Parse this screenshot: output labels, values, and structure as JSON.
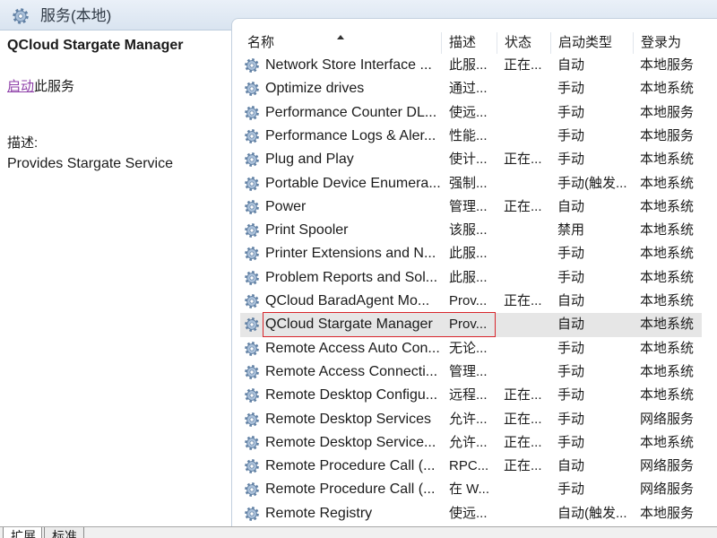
{
  "window": {
    "title": "服务(本地)",
    "icon": "gear-icon"
  },
  "details": {
    "service_name": "QCloud Stargate Manager",
    "action_link": "启动",
    "action_text": "此服务",
    "description_label": "描述:",
    "description": "Provides Stargate Service"
  },
  "list": {
    "columns": [
      "名称",
      "描述",
      "状态",
      "启动类型",
      "登录为"
    ],
    "sort_icon": "sort-ascending-icon",
    "rows": [
      {
        "icon": "service-gear-icon",
        "name": "Network Store Interface ...",
        "description": "此服...",
        "status": "正在...",
        "startup_type": "自动",
        "log_on_as": "本地服务"
      },
      {
        "icon": "service-gear-icon",
        "name": "Optimize drives",
        "description": "通过...",
        "status": "",
        "startup_type": "手动",
        "log_on_as": "本地系统"
      },
      {
        "icon": "service-gear-icon",
        "name": "Performance Counter DL...",
        "description": "使远...",
        "status": "",
        "startup_type": "手动",
        "log_on_as": "本地服务"
      },
      {
        "icon": "service-gear-icon",
        "name": "Performance Logs & Aler...",
        "description": "性能...",
        "status": "",
        "startup_type": "手动",
        "log_on_as": "本地服务"
      },
      {
        "icon": "service-gear-icon",
        "name": "Plug and Play",
        "description": "使计...",
        "status": "正在...",
        "startup_type": "手动",
        "log_on_as": "本地系统"
      },
      {
        "icon": "service-gear-icon",
        "name": "Portable Device Enumera...",
        "description": "强制...",
        "status": "",
        "startup_type": "手动(触发...",
        "log_on_as": "本地系统"
      },
      {
        "icon": "service-gear-icon",
        "name": "Power",
        "description": "管理...",
        "status": "正在...",
        "startup_type": "自动",
        "log_on_as": "本地系统"
      },
      {
        "icon": "service-gear-icon",
        "name": "Print Spooler",
        "description": "该服...",
        "status": "",
        "startup_type": "禁用",
        "log_on_as": "本地系统"
      },
      {
        "icon": "service-gear-icon",
        "name": "Printer Extensions and N...",
        "description": "此服...",
        "status": "",
        "startup_type": "手动",
        "log_on_as": "本地系统"
      },
      {
        "icon": "service-gear-icon",
        "name": "Problem Reports and Sol...",
        "description": "此服...",
        "status": "",
        "startup_type": "手动",
        "log_on_as": "本地系统"
      },
      {
        "icon": "service-gear-icon",
        "name": "QCloud BaradAgent Mo...",
        "description": "Prov...",
        "status": "正在...",
        "startup_type": "自动",
        "log_on_as": "本地系统"
      },
      {
        "icon": "service-gear-icon",
        "name": "QCloud Stargate Manager",
        "description": "Prov...",
        "status": "",
        "startup_type": "自动",
        "log_on_as": "本地系统",
        "selected": true,
        "outlined": true
      },
      {
        "icon": "service-gear-icon",
        "name": "Remote Access Auto Con...",
        "description": "无论...",
        "status": "",
        "startup_type": "手动",
        "log_on_as": "本地系统"
      },
      {
        "icon": "service-gear-icon",
        "name": "Remote Access Connecti...",
        "description": "管理...",
        "status": "",
        "startup_type": "手动",
        "log_on_as": "本地系统"
      },
      {
        "icon": "service-gear-icon",
        "name": "Remote Desktop Configu...",
        "description": "远程...",
        "status": "正在...",
        "startup_type": "手动",
        "log_on_as": "本地系统"
      },
      {
        "icon": "service-gear-icon",
        "name": "Remote Desktop Services",
        "description": "允许...",
        "status": "正在...",
        "startup_type": "手动",
        "log_on_as": "网络服务"
      },
      {
        "icon": "service-gear-icon",
        "name": "Remote Desktop Service...",
        "description": "允许...",
        "status": "正在...",
        "startup_type": "手动",
        "log_on_as": "本地系统"
      },
      {
        "icon": "service-gear-icon",
        "name": "Remote Procedure Call (...",
        "description": "RPC...",
        "status": "正在...",
        "startup_type": "自动",
        "log_on_as": "网络服务"
      },
      {
        "icon": "service-gear-icon",
        "name": "Remote Procedure Call (...",
        "description": "在 W...",
        "status": "",
        "startup_type": "手动",
        "log_on_as": "网络服务"
      },
      {
        "icon": "service-gear-icon",
        "name": "Remote Registry",
        "description": "使远...",
        "status": "",
        "startup_type": "自动(触发...",
        "log_on_as": "本地服务"
      }
    ]
  },
  "tabs": [
    {
      "label": "扩展",
      "active": true
    },
    {
      "label": "标准",
      "active": false
    }
  ],
  "colors": {
    "link": "#8e3fa8",
    "selected_row": "#e6e6e6",
    "outline": "#d8262c",
    "title_bar": "#d9e4f0"
  }
}
